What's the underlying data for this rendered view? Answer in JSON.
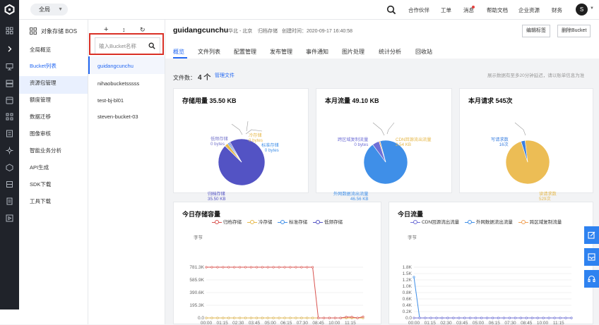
{
  "topbar": {
    "region": "全局",
    "links": [
      "合作伙伴",
      "工单",
      "消息",
      "帮助文档",
      "企业资源",
      "财务"
    ],
    "user_initial": "S"
  },
  "sidebar": {
    "title": "对象存储 BOS",
    "items": [
      "全局概览",
      "Bucket列表",
      "资源包管理",
      "额度管理",
      "数据迁移",
      "图像审核",
      "智能业务分析",
      "API生成",
      "SDK下载",
      "工具下载"
    ],
    "active_index": 1
  },
  "bucket_panel": {
    "tools": [
      "+",
      "↕",
      "↻"
    ],
    "search_placeholder": "输入Bucket名称",
    "search_value": "",
    "buckets": [
      "guidangcunchu",
      "nihaobucketsssss",
      "test-bj-bl01",
      "steven-bucket-03"
    ],
    "active_index": 0
  },
  "header": {
    "bucket_name": "guidangcunchu",
    "region": "华北 - 北京",
    "storage_class": "归档存储",
    "created_label": "创建时间：2020-09-17 16:40:58",
    "edit_tag_button": "编辑标签",
    "delete_button": "删除Bucket"
  },
  "tabs": [
    "概览",
    "文件列表",
    "配置管理",
    "发布管理",
    "事件通知",
    "图片处理",
    "统计分析",
    "回收站"
  ],
  "active_tab": 0,
  "file_count": {
    "label": "文件数：",
    "value": "4 个",
    "manage_link": "管理文件"
  },
  "data_note": "展示数据有至多20分钟延迟，请以账单信息为准",
  "colors": {
    "accent": "#2468f2",
    "archive": "#5353c4",
    "cold": "#e6b84a",
    "standard": "#3f8fe8",
    "low_freq": "#7777cc",
    "outbound": "#3f8fe8",
    "cdn": "#6f6fd6",
    "cross_region": "#f0a054",
    "write": "#3a7fe0",
    "read": "#ecbd55",
    "highlight_box": "#d93026"
  },
  "cards": {
    "storage": {
      "title": "存储用量 35.50 KB",
      "labels": [
        {
          "name": "低频存储",
          "value": "0 bytes"
        },
        {
          "name": "冷存储",
          "value": "0 bytes"
        },
        {
          "name": "标准存储",
          "value": "0 bytes"
        },
        {
          "name": "归档存储",
          "value": "35.50 KB"
        }
      ]
    },
    "traffic": {
      "title": "本月流量 49.10 KB",
      "labels": [
        {
          "name": "跨区域复制流量",
          "value": "0 bytes"
        },
        {
          "name": "CDN回源流出流量",
          "value": "2.54 KB"
        },
        {
          "name": "外网数据流出流量",
          "value": "46.56 KB"
        }
      ]
    },
    "requests": {
      "title": "本月请求 545次",
      "labels": [
        {
          "name": "写请求数",
          "value": "16次"
        },
        {
          "name": "读请求数",
          "value": "529次"
        }
      ]
    }
  },
  "chart_data": [
    {
      "type": "pie",
      "title": "存储用量 35.50 KB",
      "categories": [
        "归档存储",
        "冷存储",
        "标准存储",
        "低频存储"
      ],
      "values": [
        35.5,
        0.9,
        0.35,
        0.35
      ],
      "unit": "KB",
      "display_values": [
        "35.50 KB",
        "0 bytes",
        "0 bytes",
        "0 bytes"
      ]
    },
    {
      "type": "pie",
      "title": "本月流量 49.10 KB",
      "categories": [
        "外网数据流出流量",
        "CDN回源流出流量",
        "跨区域复制流量"
      ],
      "values": [
        46.56,
        2.54,
        0.4
      ],
      "unit": "KB",
      "display_values": [
        "46.56 KB",
        "2.54 KB",
        "0 bytes"
      ]
    },
    {
      "type": "pie",
      "title": "本月请求 545次",
      "categories": [
        "读请求数",
        "写请求数"
      ],
      "values": [
        529,
        16
      ],
      "display_values": [
        "529次",
        "16次"
      ]
    },
    {
      "type": "line",
      "title": "今日存储容量",
      "ylabel": "字节",
      "yticks": [
        "0.0",
        "195.3K",
        "390.6K",
        "585.9K",
        "781.3K"
      ],
      "ylim": [
        0,
        781300
      ],
      "x": [
        "00:00",
        "01:15",
        "02:30",
        "03:45",
        "05:00",
        "06:15",
        "07:30",
        "08:45",
        "10:00",
        "11:15"
      ],
      "series": [
        {
          "name": "归档存储",
          "values": [
            781300,
            781300,
            781300,
            781300,
            781300,
            781300,
            781300,
            781300,
            781300,
            781300,
            781300,
            781300,
            781300,
            781300,
            781300,
            781300,
            781300,
            781300,
            781300,
            781300,
            0,
            0,
            0,
            0,
            0,
            14000,
            14000,
            0,
            18000
          ]
        },
        {
          "name": "冷存储",
          "values": [
            0,
            0,
            0,
            0,
            0,
            0,
            0,
            0,
            0,
            0,
            0,
            0,
            0,
            0,
            0,
            0,
            0,
            0,
            0,
            0,
            0,
            0,
            0,
            0,
            0,
            0,
            0,
            0,
            0
          ]
        },
        {
          "name": "标准存储",
          "values": [
            0,
            0,
            0,
            0,
            0,
            0,
            0,
            0,
            0,
            0,
            0,
            0,
            0,
            0,
            0,
            0,
            0,
            0,
            0,
            0,
            0,
            0,
            0,
            0,
            0,
            0,
            0,
            0,
            0
          ]
        },
        {
          "name": "低频存储",
          "values": [
            0,
            0,
            0,
            0,
            0,
            0,
            0,
            0,
            0,
            0,
            0,
            0,
            0,
            0,
            0,
            0,
            0,
            0,
            0,
            0,
            0,
            0,
            0,
            0,
            0,
            0,
            0,
            0,
            0
          ]
        }
      ]
    },
    {
      "type": "line",
      "title": "今日流量",
      "ylabel": "字节",
      "yticks": [
        "0.0",
        "0.2K",
        "0.4K",
        "0.6K",
        "0.8K",
        "1.0K",
        "1.2K",
        "1.5K",
        "1.8K"
      ],
      "ylim": [
        0,
        1800
      ],
      "x": [
        "00:00",
        "01:15",
        "02:30",
        "03:45",
        "05:00",
        "06:15",
        "07:30",
        "08:45",
        "10:00",
        "11:15"
      ],
      "series": [
        {
          "name": "CDN回源流出流量",
          "values": [
            0,
            0,
            0,
            0,
            0,
            0,
            0,
            0,
            0,
            0,
            0,
            0,
            0,
            0,
            0,
            0,
            0,
            0,
            0,
            0,
            0,
            0,
            0,
            0,
            0,
            0,
            0,
            0,
            0
          ]
        },
        {
          "name": "外网数据流出流量",
          "values": [
            1450,
            0,
            0,
            0,
            0,
            0,
            0,
            0,
            0,
            0,
            0,
            0,
            0,
            0,
            0,
            0,
            0,
            0,
            0,
            0,
            0,
            0,
            0,
            0,
            0,
            0,
            0,
            0,
            0
          ]
        },
        {
          "name": "跨区域复制流量",
          "values": [
            0,
            0,
            0,
            0,
            0,
            0,
            0,
            0,
            0,
            0,
            0,
            0,
            0,
            0,
            0,
            0,
            0,
            0,
            0,
            0,
            0,
            0,
            0,
            0,
            0,
            0,
            0,
            0,
            0
          ]
        }
      ]
    }
  ]
}
